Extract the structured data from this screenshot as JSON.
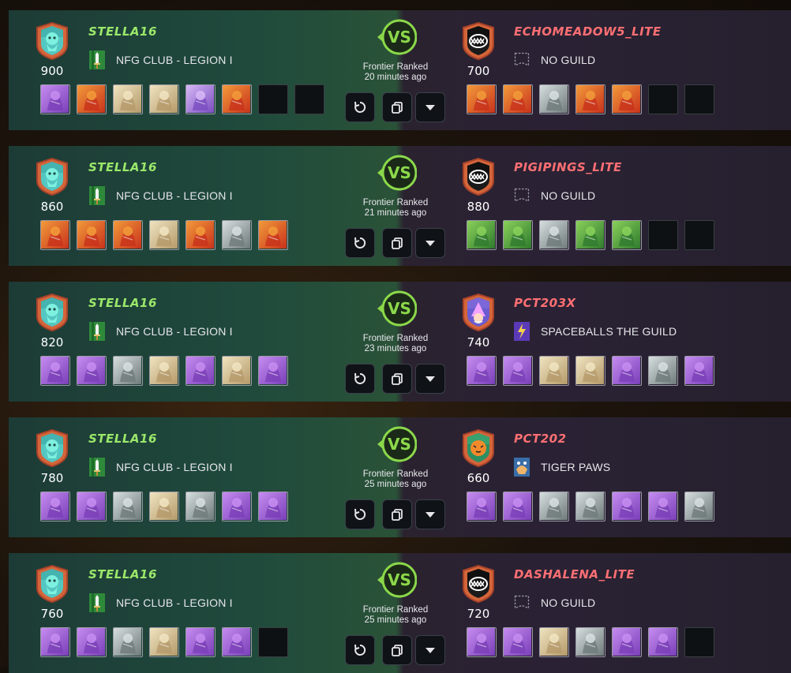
{
  "colors": {
    "player_name": "#9be86a",
    "opponent_name": "#ff6f73",
    "vs_accent": "#8bd84a"
  },
  "matches": [
    {
      "player": {
        "name": "STELLA16",
        "rating": "900",
        "guild": "NFG CLUB - LEGION I",
        "guild_icon": "sword-banner-icon",
        "avatar_icon": "ghost-avatar-icon",
        "cards": [
          "death",
          "fire",
          "light",
          "light",
          "water",
          "fire",
          "empty",
          "empty"
        ]
      },
      "mode": "Frontier Ranked",
      "time": "20 minutes ago",
      "opponent": {
        "name": "ECHOMEADOW5_LITE",
        "rating": "700",
        "guild": "NO GUILD",
        "guild_icon": "empty-guild-icon",
        "avatar_icon": "monster-mouth-icon",
        "cards": [
          "fire",
          "fire",
          "neutral",
          "fire",
          "fire",
          "empty",
          "empty"
        ]
      }
    },
    {
      "player": {
        "name": "STELLA16",
        "rating": "860",
        "guild": "NFG CLUB - LEGION I",
        "guild_icon": "sword-banner-icon",
        "avatar_icon": "ghost-avatar-icon",
        "cards": [
          "fire",
          "fire",
          "fire",
          "light",
          "fire",
          "neutral",
          "fire"
        ]
      },
      "mode": "Frontier Ranked",
      "time": "21 minutes ago",
      "opponent": {
        "name": "PIGIPINGS_LITE",
        "rating": "880",
        "guild": "NO GUILD",
        "guild_icon": "empty-guild-icon",
        "avatar_icon": "monster-mouth-icon",
        "cards": [
          "earth",
          "earth",
          "neutral",
          "earth",
          "earth",
          "empty",
          "empty"
        ]
      }
    },
    {
      "player": {
        "name": "STELLA16",
        "rating": "820",
        "guild": "NFG CLUB - LEGION I",
        "guild_icon": "sword-banner-icon",
        "avatar_icon": "ghost-avatar-icon",
        "cards": [
          "death",
          "death",
          "neutral",
          "light",
          "death",
          "light",
          "death"
        ]
      },
      "mode": "Frontier Ranked",
      "time": "23 minutes ago",
      "opponent": {
        "name": "PCT203X",
        "rating": "740",
        "guild": "SPACEBALLS THE GUILD",
        "guild_icon": "lightning-banner-icon",
        "avatar_icon": "wizard-avatar-icon",
        "cards": [
          "death",
          "death",
          "light",
          "light",
          "death",
          "neutral",
          "death"
        ]
      }
    },
    {
      "player": {
        "name": "STELLA16",
        "rating": "780",
        "guild": "NFG CLUB - LEGION I",
        "guild_icon": "sword-banner-icon",
        "avatar_icon": "ghost-avatar-icon",
        "cards": [
          "death",
          "death",
          "neutral",
          "light",
          "neutral",
          "death",
          "death"
        ]
      },
      "mode": "Frontier Ranked",
      "time": "25 minutes ago",
      "opponent": {
        "name": "PCT202",
        "rating": "660",
        "guild": "TIGER PAWS",
        "guild_icon": "paw-banner-icon",
        "avatar_icon": "tiger-avatar-icon",
        "cards": [
          "death",
          "death",
          "neutral",
          "neutral",
          "death",
          "death",
          "neutral"
        ]
      }
    },
    {
      "player": {
        "name": "STELLA16",
        "rating": "760",
        "guild": "NFG CLUB - LEGION I",
        "guild_icon": "sword-banner-icon",
        "avatar_icon": "ghost-avatar-icon",
        "cards": [
          "death",
          "death",
          "neutral",
          "light",
          "death",
          "death",
          "empty"
        ]
      },
      "mode": "Frontier Ranked",
      "time": "25 minutes ago",
      "opponent": {
        "name": "DASHALENA_LITE",
        "rating": "720",
        "guild": "NO GUILD",
        "guild_icon": "empty-guild-icon",
        "avatar_icon": "monster-mouth-icon",
        "cards": [
          "death",
          "death",
          "light",
          "neutral",
          "death",
          "death",
          "empty"
        ]
      }
    }
  ]
}
